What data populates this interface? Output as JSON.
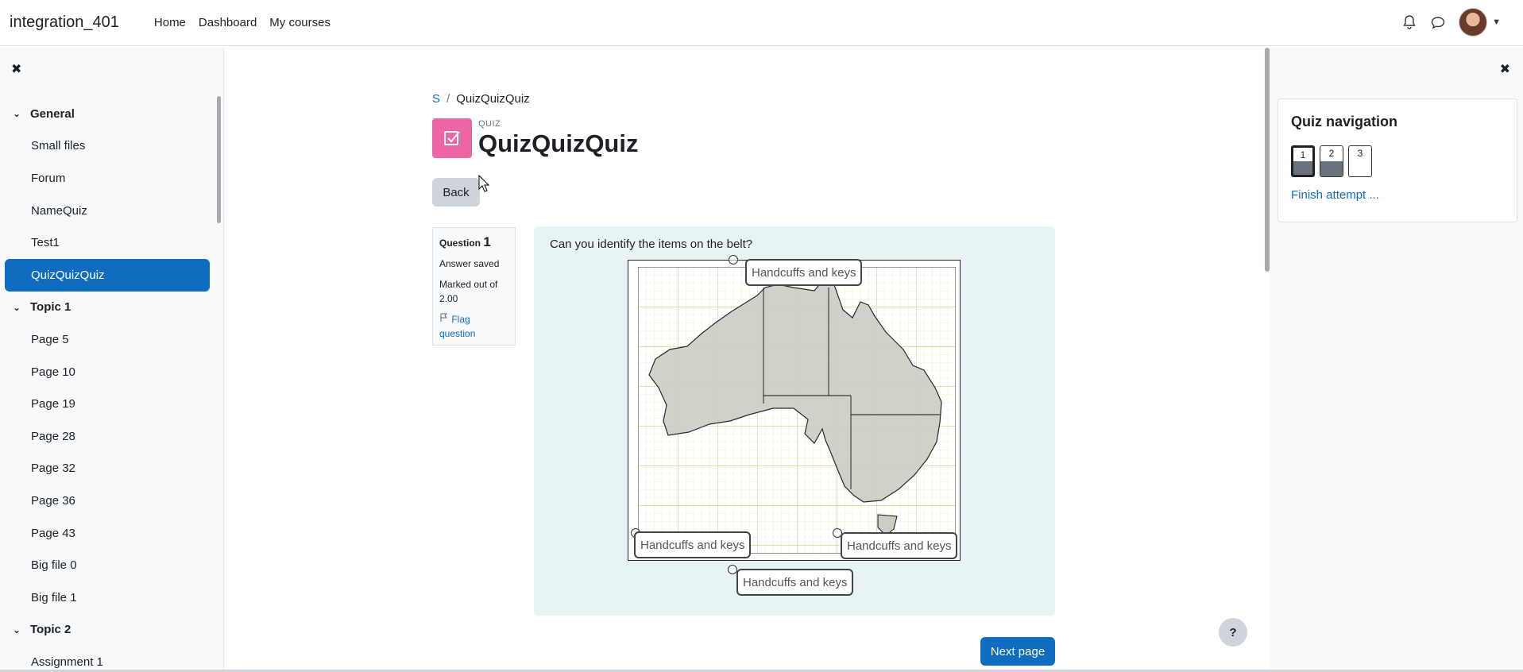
{
  "navbar": {
    "brand": "integration_401",
    "links": [
      "Home",
      "Dashboard",
      "My courses"
    ]
  },
  "left_drawer": {
    "items": [
      {
        "label": "General",
        "type": "section"
      },
      {
        "label": "Small files",
        "type": "item"
      },
      {
        "label": "Forum",
        "type": "item"
      },
      {
        "label": "NameQuiz",
        "type": "item"
      },
      {
        "label": "Test1",
        "type": "item"
      },
      {
        "label": "QuizQuizQuiz",
        "type": "item",
        "active": true
      },
      {
        "label": "Topic 1",
        "type": "section"
      },
      {
        "label": "Page 5",
        "type": "item"
      },
      {
        "label": "Page 10",
        "type": "item"
      },
      {
        "label": "Page 19",
        "type": "item"
      },
      {
        "label": "Page 28",
        "type": "item"
      },
      {
        "label": "Page 32",
        "type": "item"
      },
      {
        "label": "Page 36",
        "type": "item"
      },
      {
        "label": "Page 43",
        "type": "item"
      },
      {
        "label": "Big file 0",
        "type": "item"
      },
      {
        "label": "Big file 1",
        "type": "item"
      },
      {
        "label": "Topic 2",
        "type": "section"
      },
      {
        "label": "Assignment 1",
        "type": "item"
      }
    ]
  },
  "breadcrumb": {
    "first": "S",
    "separator": "/",
    "current": "QuizQuizQuiz"
  },
  "activity": {
    "kind": "QUIZ",
    "title": "QuizQuizQuiz",
    "back_label": "Back"
  },
  "question_info": {
    "label": "Question",
    "number": "1",
    "state": "Answer saved",
    "marked_out_of": "Marked out of 2.00",
    "flag_label": "Flag question"
  },
  "question": {
    "text": "Can you identify the items on the belt?",
    "drag_labels": [
      "Handcuffs and keys",
      "Handcuffs and keys",
      "Handcuffs and keys",
      "Handcuffs and keys"
    ],
    "next_label": "Next page"
  },
  "help": {
    "label": "?"
  },
  "quiz_nav": {
    "title": "Quiz navigation",
    "questions": [
      {
        "number": "1",
        "answered": true,
        "current": true
      },
      {
        "number": "2",
        "answered": true,
        "current": false
      },
      {
        "number": "3",
        "answered": false,
        "current": false
      }
    ],
    "finish_label": "Finish attempt ..."
  },
  "colors": {
    "primary": "#0f6cbf",
    "quiz_icon": "#eb66a2",
    "question_bg": "#e7f3f5",
    "grid_line": "#9be24b",
    "land": "#cdcdc4"
  },
  "icons": [
    "close-icon",
    "bell-icon",
    "chat-icon",
    "chevron-down-icon",
    "quiz-checkbox-icon",
    "flag-icon",
    "mouse-cursor-icon"
  ]
}
